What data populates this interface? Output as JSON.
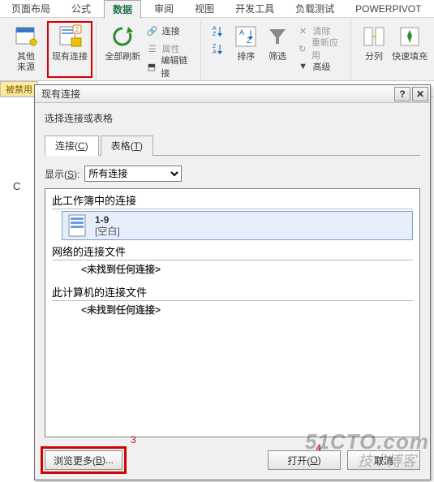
{
  "ribbon_tabs": {
    "t0": "页面布局",
    "t1": "公式",
    "t2": "数据",
    "t3": "审阅",
    "t4": "视图",
    "t5": "开发工具",
    "t6": "负载测试",
    "t7": "POWERPIVOT"
  },
  "ribbon": {
    "other_source": "其他\n来源",
    "existing_conn": "现有连接",
    "refresh_all": "全部刷新",
    "conn": "连接",
    "props": "属性",
    "edit_links": "编辑链接",
    "sort_az": "A↓Z",
    "sort_za": "Z↓A",
    "sort": "排序",
    "filter": "筛选",
    "clear": "清除",
    "reapply": "重新应用",
    "advanced": "高级",
    "text_to_cols": "分列",
    "flash_fill": "快速填充"
  },
  "sheet": {
    "warn_cell": "被禁用",
    "col_c": "C"
  },
  "dialog": {
    "title": "现有连接",
    "help": "?",
    "close": "✕",
    "subtitle": "选择连接或表格",
    "tab_conn": "连接(C)",
    "tab_tables": "表格(T)",
    "show_label": "显示(S):",
    "show_value": "所有连接",
    "sections": {
      "workbook": "此工作簿中的连接",
      "network": "网络的连接文件",
      "computer": "此计算机的连接文件"
    },
    "conn_item": {
      "name": "1-9",
      "desc": "[空白]"
    },
    "not_found": "<未找到任何连接>",
    "browse_more": "浏览更多(B)...",
    "open": "打开(O)",
    "cancel": "取消",
    "annot3": "3",
    "annot4": "4"
  },
  "watermark": {
    "line1": "51CTO.com",
    "line2": "技术博客"
  }
}
